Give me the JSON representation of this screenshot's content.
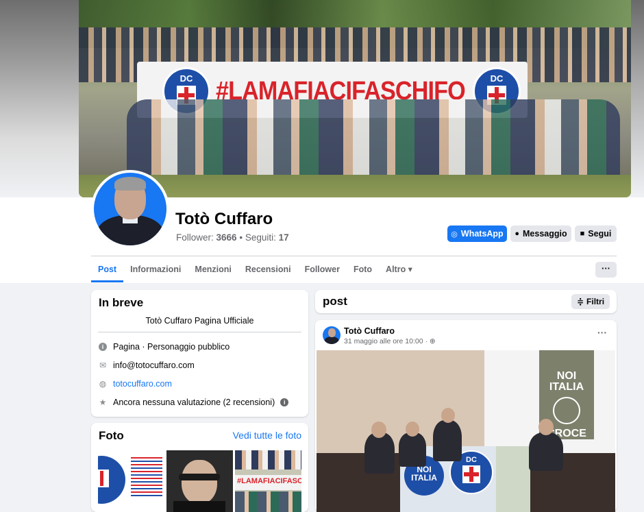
{
  "cover": {
    "banner_text": "#LAMAFIACIFASCHIFO",
    "logo_text": "DC"
  },
  "profile": {
    "name": "Totò Cuffaro",
    "followers_label": "Follower:",
    "followers_count": "3666",
    "separator": "•",
    "following_label": "Seguiti:",
    "following_count": "17"
  },
  "actions": {
    "whatsapp": "WhatsApp",
    "message": "Messaggio",
    "follow": "Segui",
    "more": "···"
  },
  "tabs": [
    "Post",
    "Informazioni",
    "Menzioni",
    "Recensioni",
    "Follower",
    "Foto",
    "Altro ▾"
  ],
  "intro": {
    "title": "In breve",
    "description": "Totò Cuffaro Pagina Ufficiale",
    "category": "Pagina · Personaggio pubblico",
    "email": "info@totocuffaro.com",
    "website": "totocuffaro.com",
    "rating": "Ancora nessuna valutazione (2 recensioni)",
    "rating_info": "i"
  },
  "photos": {
    "title": "Foto",
    "see_all": "Vedi tutte le foto",
    "thumb3_text": "#LAMAFIACIFASCHIFO"
  },
  "feed": {
    "title": "post",
    "filter": "Filtri"
  },
  "post": {
    "author": "Totò Cuffaro",
    "date": "31 maggio alle ore 10:00 · ",
    "dots": "···",
    "poster_line1": "NOI",
    "poster_line2": "ITALIA",
    "poster_line3": "CROCE",
    "banner_line1": "NOI",
    "banner_line2": "ITALIA",
    "banner_logo": "DC"
  },
  "colors": {
    "accent": "#1877f2",
    "banner_red": "#d9232a",
    "page_bg": "#f0f2f5"
  }
}
